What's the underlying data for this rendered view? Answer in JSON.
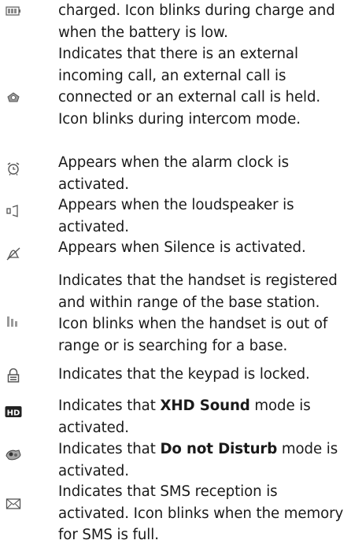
{
  "rows": [
    {
      "id": "battery",
      "icon": "battery-icon",
      "lines": [
        "charged. Icon blinks during charge and",
        "when the battery is low."
      ]
    },
    {
      "id": "external-call",
      "icon": "phone-call-icon",
      "lines": [
        "Indicates that there is an external",
        "incoming call, an external call is",
        "connected or an external call is held.",
        "Icon blinks during intercom mode."
      ]
    },
    {
      "id": "alarm",
      "icon": "alarm-clock-icon",
      "lines": [
        "Appears when the alarm clock is",
        "activated."
      ]
    },
    {
      "id": "loudspeaker",
      "icon": "loudspeaker-icon",
      "lines": [
        "Appears when the loudspeaker is",
        "activated."
      ]
    },
    {
      "id": "silence",
      "icon": "silence-bell-icon",
      "lines": [
        "Appears when Silence is activated."
      ]
    },
    {
      "id": "signal",
      "icon": "signal-bars-icon",
      "lines": [
        "Indicates that the handset is registered",
        "and within range of the base station.",
        "Icon blinks when the handset is out of",
        "range or is searching for a base."
      ]
    },
    {
      "id": "keypad-lock",
      "icon": "padlock-icon",
      "lines": [
        "Indicates that the keypad is locked."
      ]
    },
    {
      "id": "xhd",
      "icon": "hd-icon",
      "line1_pre": "Indicates that ",
      "line1_bold": "XHD Sound",
      "line1_post": " mode is",
      "line2": "activated."
    },
    {
      "id": "dnd",
      "icon": "do-not-disturb-icon",
      "line1_pre": "Indicates that ",
      "line1_bold": "Do not Disturb",
      "line1_post": " mode is",
      "line2": "activated."
    },
    {
      "id": "sms",
      "icon": "envelope-icon",
      "lines": [
        "Indicates that SMS reception is",
        "activated. Icon blinks when the memory",
        "for SMS is full."
      ]
    }
  ]
}
